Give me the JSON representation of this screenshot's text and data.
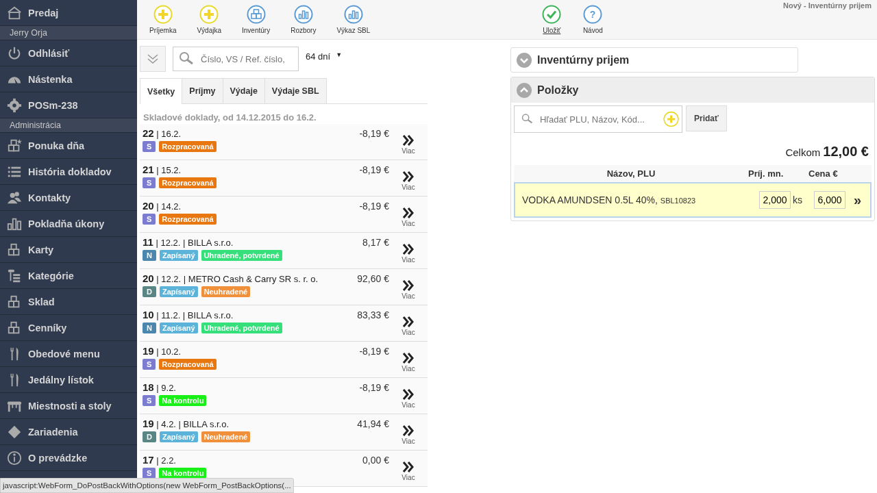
{
  "sidebar": {
    "items": [
      {
        "kind": "item",
        "label": "Predaj"
      },
      {
        "kind": "section",
        "label": "Jerry Orja"
      },
      {
        "kind": "item",
        "label": "Odhlásiť"
      },
      {
        "kind": "item",
        "label": "Nástenka"
      },
      {
        "kind": "item",
        "label": "POSm-238"
      },
      {
        "kind": "section",
        "label": "Administrácia"
      },
      {
        "kind": "item",
        "label": "Ponuka dňa"
      },
      {
        "kind": "item",
        "label": "História dokladov"
      },
      {
        "kind": "item",
        "label": "Kontakty"
      },
      {
        "kind": "item",
        "label": "Pokladňa úkony"
      },
      {
        "kind": "item",
        "label": "Karty"
      },
      {
        "kind": "item",
        "label": "Kategórie"
      },
      {
        "kind": "item",
        "label": "Sklad"
      },
      {
        "kind": "item",
        "label": "Cenníky"
      },
      {
        "kind": "item",
        "label": "Obedové menu"
      },
      {
        "kind": "item",
        "label": "Jedálny lístok"
      },
      {
        "kind": "item",
        "label": "Miestnosti a stoly"
      },
      {
        "kind": "item",
        "label": "Zariadenia"
      },
      {
        "kind": "item",
        "label": "O prevádzke"
      }
    ]
  },
  "toolbar": {
    "left": [
      {
        "kind": "add",
        "label": "Príjemka"
      },
      {
        "kind": "add",
        "label": "Výdajka"
      },
      {
        "kind": "boxes",
        "label": "Inventúry"
      },
      {
        "kind": "chart",
        "label": "Rozbory"
      },
      {
        "kind": "chart",
        "label": "Výkaz SBL"
      }
    ],
    "right": [
      {
        "kind": "save",
        "label": "Uložiť"
      },
      {
        "kind": "help",
        "label": "Návod",
        "glyph": "?"
      }
    ],
    "page_title": "Nový - Inventúrny prijem"
  },
  "filter": {
    "search_placeholder": "Číslo, VS / Ref. číslo,",
    "period": "64 dní",
    "period_arrow": "▼"
  },
  "tabs": [
    {
      "label": "Všetky",
      "selected": true
    },
    {
      "label": "Príjmy",
      "selected": false
    },
    {
      "label": "Výdaje",
      "selected": false
    },
    {
      "label": "Výdaje SBL",
      "selected": false
    }
  ],
  "list_heading": "Skladové doklady, od 14.12.2015 do 16.2.",
  "documents": [
    {
      "number": "22",
      "date": "| 16.2.",
      "amount": "-8,19 €",
      "type": {
        "letter": "S",
        "color": "#7b7bcf"
      },
      "badges": [
        {
          "label": "Rozpracovaná",
          "color": "#e8770f"
        }
      ],
      "more": "Viac"
    },
    {
      "number": "21",
      "date": "| 15.2.",
      "amount": "-8,19 €",
      "type": {
        "letter": "S",
        "color": "#7b7bcf"
      },
      "badges": [
        {
          "label": "Rozpracovaná",
          "color": "#e8770f"
        }
      ],
      "more": "Viac"
    },
    {
      "number": "20",
      "date": "| 14.2.",
      "amount": "-8,19 €",
      "type": {
        "letter": "S",
        "color": "#7b7bcf"
      },
      "badges": [
        {
          "label": "Rozpracovaná",
          "color": "#e8770f"
        }
      ],
      "more": "Viac"
    },
    {
      "number": "11",
      "date": "| 12.2.",
      "partner": "| BILLA s.r.o.",
      "amount": "8,17 €",
      "type": {
        "letter": "N",
        "color": "#4a86ad"
      },
      "badges": [
        {
          "label": "Zapísaný",
          "color": "#5bb3d9"
        },
        {
          "label": "Uhradené, potvrdené",
          "color": "#35e07a"
        }
      ],
      "more": "Viac"
    },
    {
      "number": "20",
      "date": "| 12.2.",
      "partner": "| METRO Cash & Carry SR s. r. o.",
      "amount": "92,60 €",
      "type": {
        "letter": "D",
        "color": "#5a8585"
      },
      "badges": [
        {
          "label": "Zapísaný",
          "color": "#5bb3d9"
        },
        {
          "label": "Neuhradené",
          "color": "#f0903a"
        }
      ],
      "more": "Viac"
    },
    {
      "number": "10",
      "date": "| 11.2.",
      "partner": "| BILLA s.r.o.",
      "amount": "83,33 €",
      "type": {
        "letter": "N",
        "color": "#4a86ad"
      },
      "badges": [
        {
          "label": "Zapísaný",
          "color": "#5bb3d9"
        },
        {
          "label": "Uhradené, potvrdené",
          "color": "#35e07a"
        }
      ],
      "more": "Viac"
    },
    {
      "number": "19",
      "date": "| 10.2.",
      "amount": "-8,19 €",
      "type": {
        "letter": "S",
        "color": "#7b7bcf"
      },
      "badges": [
        {
          "label": "Rozpracovaná",
          "color": "#e8770f"
        }
      ],
      "more": "Viac"
    },
    {
      "number": "18",
      "date": "| 9.2.",
      "amount": "-8,19 €",
      "type": {
        "letter": "S",
        "color": "#7b7bcf"
      },
      "badges": [
        {
          "label": "Na kontrolu",
          "color": "#18f018"
        }
      ],
      "more": "Viac"
    },
    {
      "number": "19",
      "date": "| 4.2.",
      "partner": "| BILLA s.r.o.",
      "amount": "41,94 €",
      "type": {
        "letter": "D",
        "color": "#5a8585"
      },
      "badges": [
        {
          "label": "Zapísaný",
          "color": "#5bb3d9"
        },
        {
          "label": "Neuhradené",
          "color": "#f0903a"
        }
      ],
      "more": "Viac"
    },
    {
      "number": "17",
      "date": "| 2.2.",
      "amount": "0,00 €",
      "type": {
        "letter": "S",
        "color": "#7b7bcf"
      },
      "badges": [
        {
          "label": "Na kontrolu",
          "color": "#18f018"
        }
      ],
      "more": "Viac"
    }
  ],
  "detail": {
    "sections": [
      {
        "title": "Inventúrny prijem",
        "expanded": false
      },
      {
        "title": "Položky",
        "expanded": true
      }
    ],
    "item_search_placeholder": "Hľadať PLU, Názov, Kód...",
    "add_button": "Pridať",
    "total_label": "Celkom",
    "total": "12,00 €",
    "columns": [
      "Názov, PLU",
      "Príj. mn.",
      "Cena €"
    ],
    "rows": [
      {
        "name": "VODKA AMUNDSEN 0.5L 40%,",
        "plu": "SBL10823",
        "quantity": "2,000",
        "unit": "ks",
        "price": "6,000",
        "more": "»",
        "selected": true
      }
    ]
  },
  "status_bar": "javascript:WebForm_DoPostBackWithOptions(new WebForm_PostBackOptions(..."
}
